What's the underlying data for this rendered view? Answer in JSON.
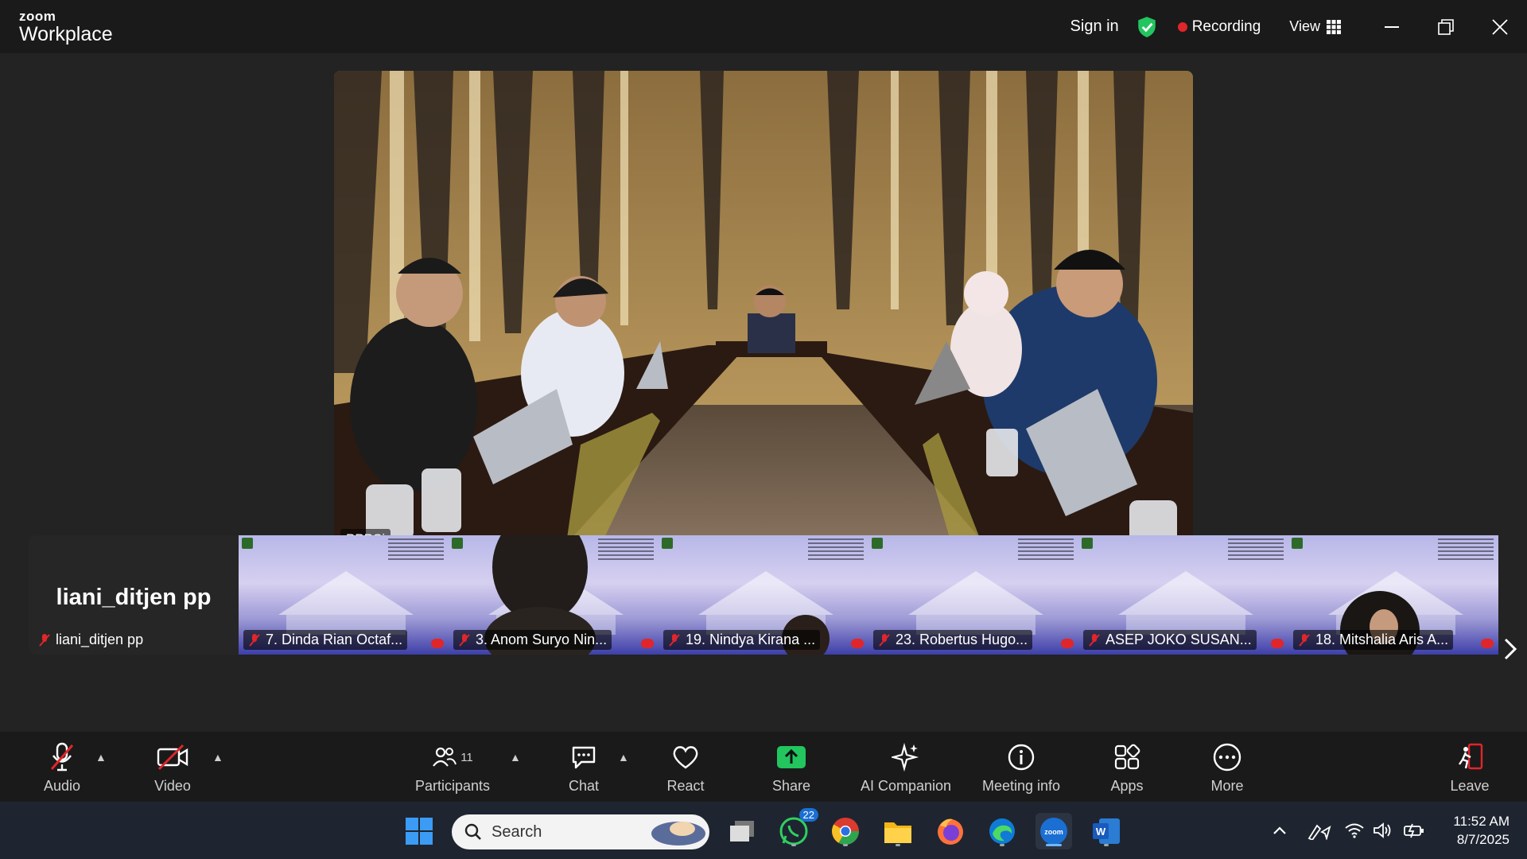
{
  "app": {
    "logo_small": "zoom",
    "logo_large": "Workplace"
  },
  "titlebar": {
    "sign_in": "Sign in",
    "recording": "Recording",
    "view": "View"
  },
  "main_video": {
    "label": "PPPSi"
  },
  "gallery": {
    "self": {
      "big_name": "liani_ditjen pp",
      "label": "liani_ditjen pp"
    },
    "tiles": [
      {
        "label": "7. Dinda Rian Octaf..."
      },
      {
        "label": "3. Anom Suryo Nin..."
      },
      {
        "label": "19. Nindya Kirana ..."
      },
      {
        "label": "23. Robertus Hugo..."
      },
      {
        "label": "ASEP JOKO SUSAN..."
      },
      {
        "label": "18. Mitshalia Aris A..."
      }
    ]
  },
  "toolbar": {
    "audio": "Audio",
    "video": "Video",
    "participants": "Participants",
    "participants_count": "11",
    "chat": "Chat",
    "react": "React",
    "share": "Share",
    "ai_companion": "AI Companion",
    "meeting_info": "Meeting info",
    "apps": "Apps",
    "more": "More",
    "leave": "Leave"
  },
  "taskbar": {
    "search_placeholder": "Search",
    "whatsapp_badge": "22",
    "time": "11:52 AM",
    "date": "8/7/2025"
  },
  "colors": {
    "recording": "#e0262b",
    "share": "#22c55e",
    "shield": "#22c55e",
    "accent": "#1b6fd3"
  }
}
